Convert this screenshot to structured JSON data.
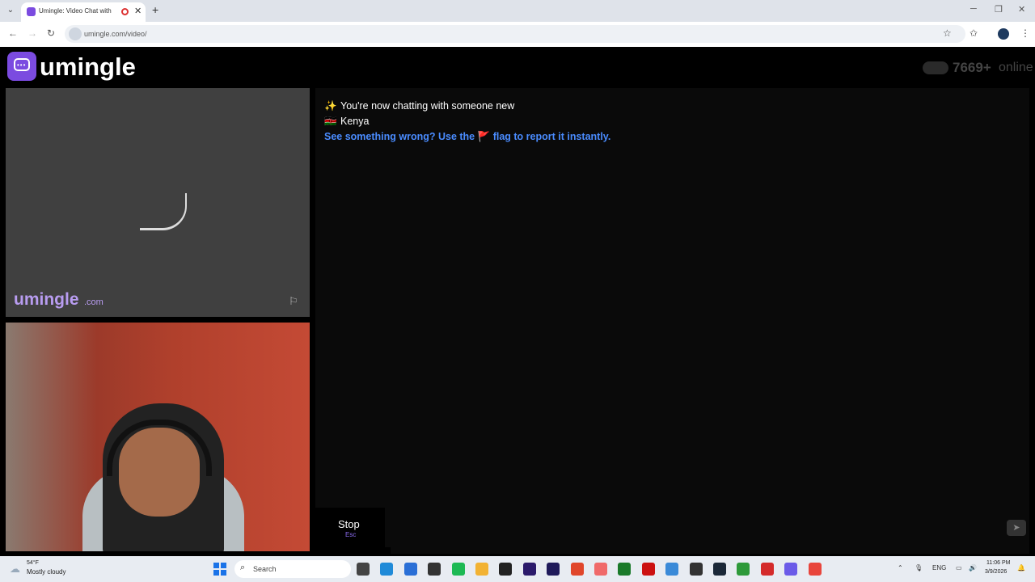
{
  "browser": {
    "tab_title": "Umingle: Video Chat with S",
    "url": "umingle.com/video/",
    "new_tab": "+",
    "close_tab": "✕"
  },
  "app": {
    "logo_text": "umingle",
    "online_count": "7669+",
    "online_label": "online"
  },
  "stranger_video": {
    "watermark_main": "umingle",
    "watermark_suffix": ".com"
  },
  "chat": {
    "messages": [
      {
        "icon": "✨",
        "text": "You're now chatting with someone new"
      },
      {
        "icon": "🇰🇪",
        "text": "Kenya"
      }
    ],
    "warning_prefix": "See something wrong? Use the",
    "warning_icon": "🚩",
    "warning_suffix": "flag to report it instantly."
  },
  "controls": {
    "stop_label": "Stop",
    "stop_key": "Esc"
  },
  "taskbar": {
    "weather_temp": "54°F",
    "weather_desc": "Mostly cloudy",
    "search_label": "Search",
    "tray_lang": "ENG",
    "time": "11:06 PM",
    "date": "3/9/2026",
    "apps": [
      {
        "name": "file-explorer-app",
        "color": "#444444"
      },
      {
        "name": "edge-app",
        "color": "#1f8ad8"
      },
      {
        "name": "store-app",
        "color": "#2a6fd6"
      },
      {
        "name": "pen-app",
        "color": "#333333"
      },
      {
        "name": "spotify-app",
        "color": "#1db954"
      },
      {
        "name": "folder-app",
        "color": "#f2b233"
      },
      {
        "name": "capcut-app",
        "color": "#222222"
      },
      {
        "name": "premiere-app",
        "color": "#2b1a6b"
      },
      {
        "name": "after-effects-app",
        "color": "#1f1a5a"
      },
      {
        "name": "brave-app",
        "color": "#e0462b"
      },
      {
        "name": "arc-app",
        "color": "#f06a6a"
      },
      {
        "name": "terminal-app",
        "color": "#1a7a2a"
      },
      {
        "name": "record-app",
        "color": "#cc1111"
      },
      {
        "name": "notepad-app",
        "color": "#3a8ad8"
      },
      {
        "name": "obs-app",
        "color": "#333333"
      },
      {
        "name": "steam-app",
        "color": "#1b2838"
      },
      {
        "name": "xbox-app",
        "color": "#2e9a3a"
      },
      {
        "name": "acrobat-app",
        "color": "#d42b2b"
      },
      {
        "name": "discord-app",
        "color": "#6b5be8"
      },
      {
        "name": "chrome-app",
        "color": "#e8453c"
      }
    ]
  }
}
